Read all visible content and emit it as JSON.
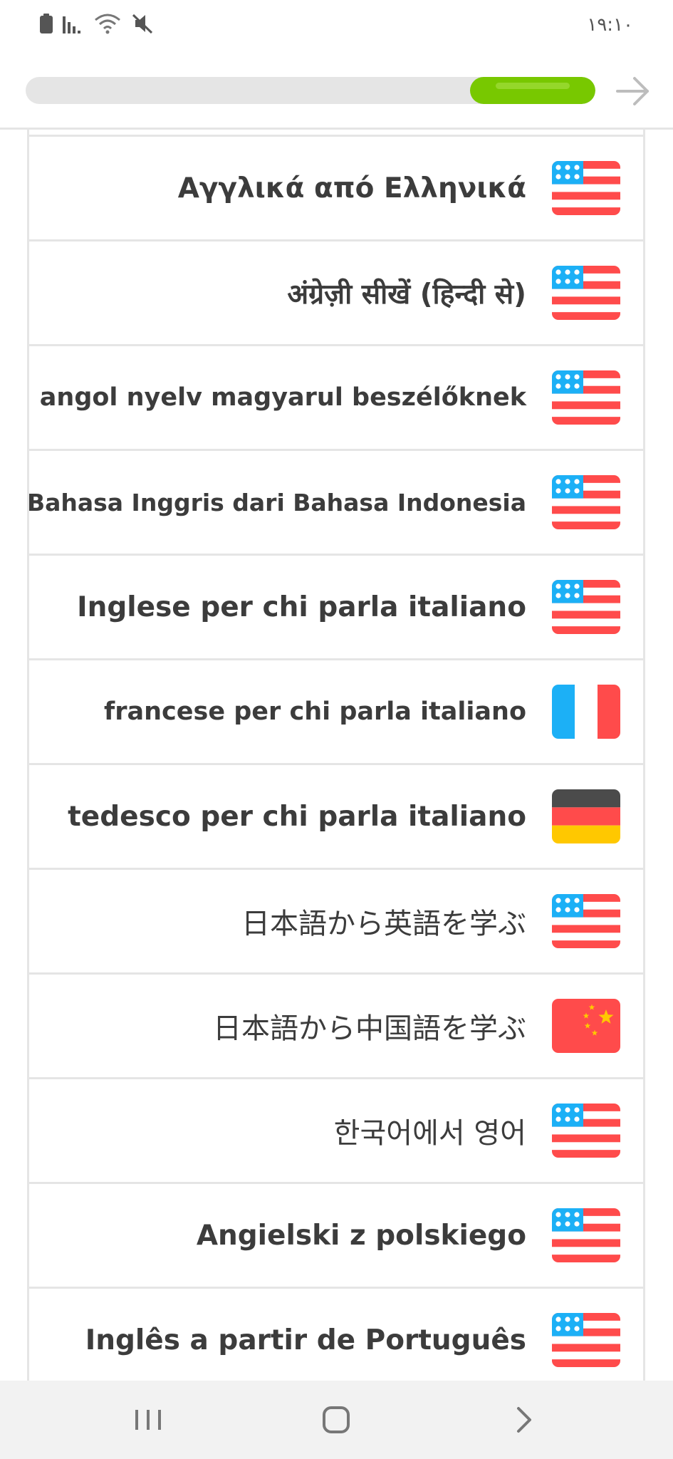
{
  "status_bar": {
    "time": "١٩:١٠",
    "icons": [
      "battery-icon",
      "signal-icon",
      "wifi-icon",
      "mute-icon"
    ]
  },
  "progress": {
    "fraction": 0.22,
    "fill_color": "#78c800"
  },
  "header": {
    "next_icon": "arrow-right-icon"
  },
  "courses": [
    {
      "label": "Αγγλικά από Ελληνικά",
      "flag": "us"
    },
    {
      "label": "अंग्रेज़ी सीखें (हिन्दी से)",
      "flag": "us"
    },
    {
      "label": "angol nyelv magyarul beszélőknek",
      "flag": "us"
    },
    {
      "label": "Bahasa Inggris dari Bahasa Indonesia",
      "flag": "us"
    },
    {
      "label": "Inglese per chi parla italiano",
      "flag": "us"
    },
    {
      "label": "francese per chi parla italiano",
      "flag": "fr"
    },
    {
      "label": "tedesco per chi parla italiano",
      "flag": "de"
    },
    {
      "label": "日本語から英語を学ぶ",
      "flag": "us"
    },
    {
      "label": "日本語から中国語を学ぶ",
      "flag": "cn"
    },
    {
      "label": "한국어에서 영어",
      "flag": "us"
    },
    {
      "label": "Angielski z polskiego",
      "flag": "us"
    },
    {
      "label": "Inglês a partir de Português",
      "flag": "us"
    }
  ],
  "colors": {
    "us_red": "#ff4b4b",
    "us_blue": "#1cb0f6",
    "fr_blue": "#1cb0f6",
    "fr_red": "#ff4b4b",
    "de_black": "#4b4b4b",
    "de_red": "#ff4b4b",
    "de_gold": "#ffc800",
    "cn_red": "#ff4b4b",
    "cn_star": "#ffc800"
  },
  "nav_bar": {
    "icons": [
      "recent-apps-icon",
      "home-icon",
      "back-icon"
    ]
  }
}
